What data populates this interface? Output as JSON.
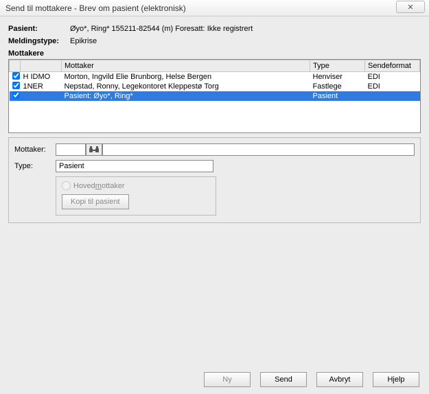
{
  "window": {
    "title": "Send til mottakere - Brev om pasient (elektronisk)",
    "close_glyph": "✕"
  },
  "patient": {
    "label": "Pasient:",
    "value": "Øyo*, Ring*  155211-82544 (m)  Foresatt: Ikke registrert"
  },
  "msgtype": {
    "label": "Meldingstype:",
    "value": "Epikrise"
  },
  "recipients": {
    "legend": "Mottakere",
    "headers": {
      "cb": "",
      "code": "",
      "name": "Mottaker",
      "type": "Type",
      "format": "Sendeformat"
    },
    "rows": [
      {
        "checked": true,
        "code": "H  IDMO",
        "name": "Morton, Ingvild Elie Brunborg, Helse Bergen",
        "type": "Henviser",
        "format": "EDI",
        "selected": false
      },
      {
        "checked": true,
        "code": "   1NER",
        "name": "Nepstad, Ronny, Legekontoret Kleppestø Torg",
        "type": "Fastlege",
        "format": "EDI",
        "selected": false
      },
      {
        "checked": true,
        "code": "",
        "name": "Pasient: Øyo*, Ring*",
        "type": "Pasient",
        "format": "",
        "selected": true
      }
    ]
  },
  "form": {
    "mottaker_label": "Mottaker:",
    "type_label": "Type:",
    "type_value": "Pasient",
    "radio_hovedmottaker": "Hovedmottaker",
    "btn_kopi": "Kopi til pasient"
  },
  "footer": {
    "ny": "Ny",
    "send": "Send",
    "avbryt": "Avbryt",
    "hjelp": "Hjelp"
  },
  "icons": {
    "search": "binoculars"
  }
}
